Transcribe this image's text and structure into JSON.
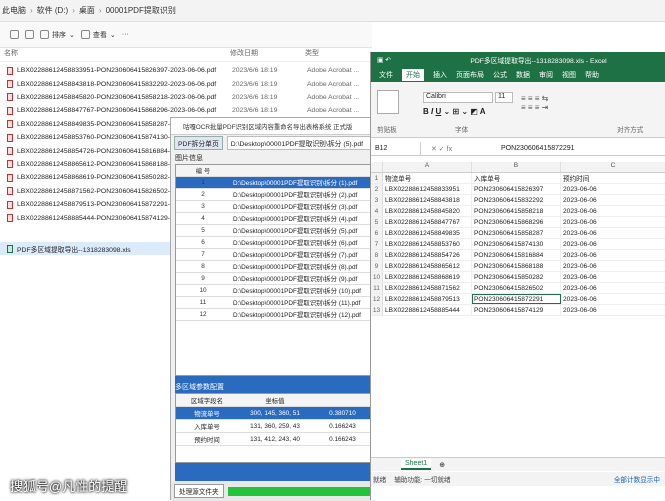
{
  "explorer": {
    "breadcrumb": [
      "此电脑",
      "软件 (D:)",
      "桌面",
      "00001PDF提取识别"
    ],
    "toolbar": {
      "sort": "排序",
      "view": "查看"
    },
    "columns": {
      "name": "名称",
      "date": "修改日期",
      "type": "类型"
    },
    "files": [
      {
        "name": "LBX02288612458833951-PON230606415826397-2023-06-06.pdf",
        "date": "2023/6/6 18:19",
        "type": "Adobe Acrobat ..."
      },
      {
        "name": "LBX02288612458843818-PON230606415832292-2023-06-06.pdf",
        "date": "2023/6/6 18:19",
        "type": "Adobe Acrobat ..."
      },
      {
        "name": "LBX02288612458845820-PON230606415858218-2023-06-06.pdf",
        "date": "2023/6/6 18:19",
        "type": "Adobe Acrobat ..."
      },
      {
        "name": "LBX02288612458847767-PON230606415868296-2023-06-06.pdf",
        "date": "2023/6/6 18:19",
        "type": "Adobe Acrobat ..."
      },
      {
        "name": "LBX02288612458849835-PON230606415858287-",
        "date": "",
        "type": ""
      },
      {
        "name": "LBX02288612458853760-PON230606415874130-",
        "date": "",
        "type": ""
      },
      {
        "name": "LBX02288612458854726-PON230606415816884-",
        "date": "",
        "type": ""
      },
      {
        "name": "LBX02288612458865612-PON230606415868188-",
        "date": "",
        "type": ""
      },
      {
        "name": "LBX02288612458868619-PON230606415850282-",
        "date": "",
        "type": ""
      },
      {
        "name": "LBX02288612458871562-PON230606415826502-",
        "date": "",
        "type": ""
      },
      {
        "name": "LBX02288612458879513-PON230606415872291-",
        "date": "",
        "type": ""
      },
      {
        "name": "LBX02288612458885444-PON230606415874129-",
        "date": "",
        "type": ""
      }
    ],
    "xls_file": "PDF多区域提取导出--1318283098.xls"
  },
  "ocr": {
    "title": "咕嘎OCR批量PDF识别区域内容重命名导出表格系统   正式版",
    "split_button": "PDF拆分单页",
    "path": "D:\\Desktop\\00001PDF提取识别\\拆分 (5).pdf",
    "img_section": "图片信息",
    "img_header": "编 号",
    "img_rows": [
      {
        "n": "1",
        "p": "D:\\Desktop\\00001PDF提取识别\\拆分 (1).pdf"
      },
      {
        "n": "2",
        "p": "D:\\Desktop\\00001PDF提取识别\\拆分 (2).pdf"
      },
      {
        "n": "3",
        "p": "D:\\Desktop\\00001PDF提取识别\\拆分 (3).pdf"
      },
      {
        "n": "4",
        "p": "D:\\Desktop\\00001PDF提取识别\\拆分 (4).pdf"
      },
      {
        "n": "5",
        "p": "D:\\Desktop\\00001PDF提取识别\\拆分 (5).pdf"
      },
      {
        "n": "6",
        "p": "D:\\Desktop\\00001PDF提取识别\\拆分 (6).pdf"
      },
      {
        "n": "7",
        "p": "D:\\Desktop\\00001PDF提取识别\\拆分 (7).pdf"
      },
      {
        "n": "8",
        "p": "D:\\Desktop\\00001PDF提取识别\\拆分 (8).pdf"
      },
      {
        "n": "9",
        "p": "D:\\Desktop\\00001PDF提取识别\\拆分 (9).pdf"
      },
      {
        "n": "10",
        "p": "D:\\Desktop\\00001PDF提取识别\\拆分 (10).pdf"
      },
      {
        "n": "11",
        "p": "D:\\Desktop\\00001PDF提取识别\\拆分 (11).pdf"
      },
      {
        "n": "12",
        "p": "D:\\Desktop\\00001PDF提取识别\\拆分 (12).pdf"
      }
    ],
    "region_section": "多区域参数配置",
    "region_headers": [
      "区域字段名",
      "坐标值",
      ""
    ],
    "region_rows": [
      {
        "a": "物流单号",
        "b": "300, 145, 360, 51",
        "c": "0.380710"
      },
      {
        "a": "入库单号",
        "b": "131, 360, 259, 43",
        "c": "0.166243"
      },
      {
        "a": "预约时间",
        "b": "131, 412, 243, 40",
        "c": "0.166243"
      }
    ],
    "footer_button": "处理源文件夹"
  },
  "excel": {
    "title": "PDF多区域提取导出--1318283098.xls  -  Excel",
    "tabs": [
      "文件",
      "开始",
      "插入",
      "页面布局",
      "公式",
      "数据",
      "审阅",
      "视图",
      "帮助"
    ],
    "active_tab": "开始",
    "font": "Calibri",
    "font_size": "11",
    "ribbon_labels": {
      "clipboard": "剪贴板",
      "font": "字体",
      "align": "对齐方式"
    },
    "name_box": "B12",
    "formula": "PON230606415872291",
    "col_letters": [
      "A",
      "B",
      "C"
    ],
    "rows": [
      [
        "物流单号",
        "入库单号",
        "预约时间"
      ],
      [
        "LBX02288612458833951",
        "PON230606415826397",
        "2023-06-06"
      ],
      [
        "LBX02288612458843818",
        "PON230606415832292",
        "2023-06-06"
      ],
      [
        "LBX02288612458845820",
        "PON230606415858218",
        "2023-06-06"
      ],
      [
        "LBX02288612458847767",
        "PON230606415868296",
        "2023-06-06"
      ],
      [
        "LBX02288612458849835",
        "PON230606415858287",
        "2023-06-06"
      ],
      [
        "LBX02288612458853760",
        "PON230606415874130",
        "2023-06-06"
      ],
      [
        "LBX02288612458854726",
        "PON230606415816884",
        "2023-06-06"
      ],
      [
        "LBX02288612458865612",
        "PON230606415868188",
        "2023-06-06"
      ],
      [
        "LBX02288612458868619",
        "PON230606415850282",
        "2023-06-06"
      ],
      [
        "LBX02288612458871562",
        "PON230606415826502",
        "2023-06-06"
      ],
      [
        "LBX02288612458879513",
        "PON230606415872291",
        "2023-06-06"
      ],
      [
        "LBX02288612458885444",
        "PON230606415874129",
        "2023-06-06"
      ]
    ],
    "sheet": "Sheet1",
    "status": [
      "就绪",
      "辅助功能: 一切就绪"
    ],
    "status_right": "全部计数显示中"
  },
  "watermark": "搜狐号@凡性的提醒"
}
